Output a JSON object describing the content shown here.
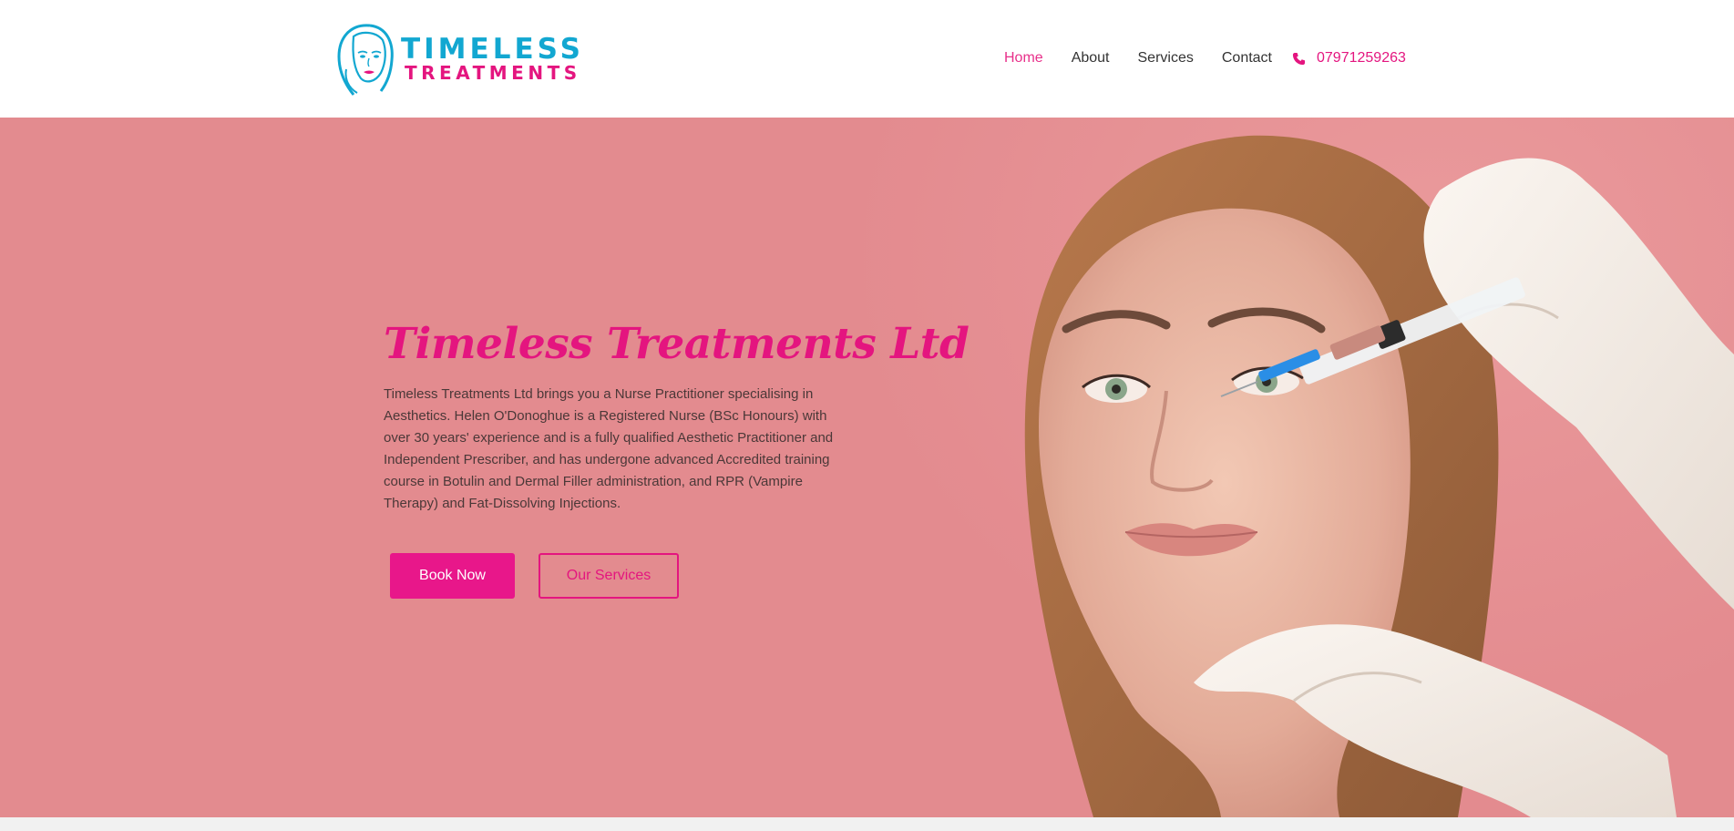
{
  "brand": {
    "name_line1": "TIMELESS",
    "name_line2": "TREATMENTS",
    "logo_icon": "woman-face-icon"
  },
  "nav": {
    "items": [
      {
        "label": "Home",
        "active": true
      },
      {
        "label": "About",
        "active": false
      },
      {
        "label": "Services",
        "active": false
      },
      {
        "label": "Contact",
        "active": false
      }
    ],
    "phone": "07971259263",
    "phone_icon": "phone-icon"
  },
  "hero": {
    "title": "Timeless Treatments Ltd",
    "description": "Timeless Treatments Ltd brings you a Nurse Practitioner specialising in Aesthetics. Helen O'Donoghue is a Registered Nurse (BSc Honours) with over 30 years' experience and is a fully qualified Aesthetic Practitioner and Independent Prescriber, and has undergone advanced Accredited training course in Botulin and Dermal Filler administration, and RPR (Vampire Therapy) and Fat-Dissolving Injections.",
    "primary_button": "Book Now",
    "secondary_button": "Our Services",
    "image": "woman-receiving-injection-photo"
  },
  "colors": {
    "brand_pink": "#e4157f",
    "brand_blue": "#12a7d1",
    "hero_bg": "#e38b8f"
  }
}
